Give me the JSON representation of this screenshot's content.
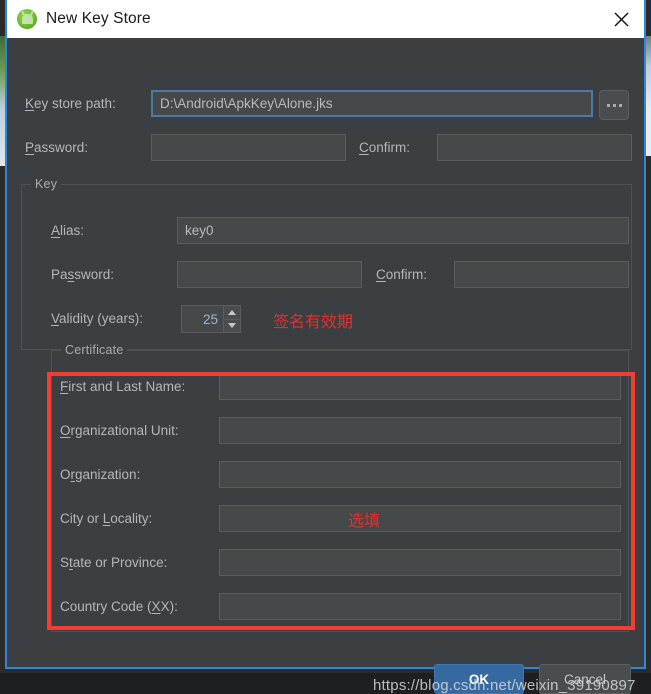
{
  "window": {
    "title": "New Key Store",
    "icon": "android-studio-icon",
    "close_label": "close-icon"
  },
  "keystore": {
    "path_label_pre": "K",
    "path_label_post": "ey store path:",
    "path_value": "D:\\Android\\ApkKey\\Alone.jks",
    "browse_label": "...",
    "password_label_pre": "P",
    "password_label_post": "assword:",
    "password_value": "",
    "confirm_label_pre": "C",
    "confirm_label_mid": "o",
    "confirm_label_post": "nfirm:",
    "confirm_value": ""
  },
  "key_group": {
    "title": "Key",
    "alias_label_pre": "A",
    "alias_label_post": "lias:",
    "alias_value": "key0",
    "password_label": "Password:",
    "password_value": "",
    "confirm_label": "Confirm:",
    "confirm_value": "",
    "validity_label_pre": "V",
    "validity_label_post": "alidity (years):",
    "validity_value": "25"
  },
  "certificate_group": {
    "title": "Certificate",
    "fields": [
      {
        "label": "First and Last Name:",
        "value": ""
      },
      {
        "label": "Organizational Unit:",
        "value": ""
      },
      {
        "label": "Organization:",
        "value": ""
      },
      {
        "label": "City or Locality:",
        "value": ""
      },
      {
        "label": "State or Province:",
        "value": ""
      },
      {
        "label": "Country Code (XX):",
        "value": ""
      }
    ]
  },
  "annotations": {
    "validity_note": "签名有效期",
    "optional_note": "选填"
  },
  "footer": {
    "ok_label": "OK",
    "cancel_label": "Cancel"
  },
  "watermark": {
    "text": "https://blog.csdn.net/weixin_39190897"
  },
  "colors": {
    "dialog_bg": "#3c3f41",
    "field_bg": "#45494a",
    "focus_border": "#4b79a8",
    "window_border": "#2f87d8",
    "annotation_red": "#f63b32",
    "ok_blue": "#36699f"
  }
}
